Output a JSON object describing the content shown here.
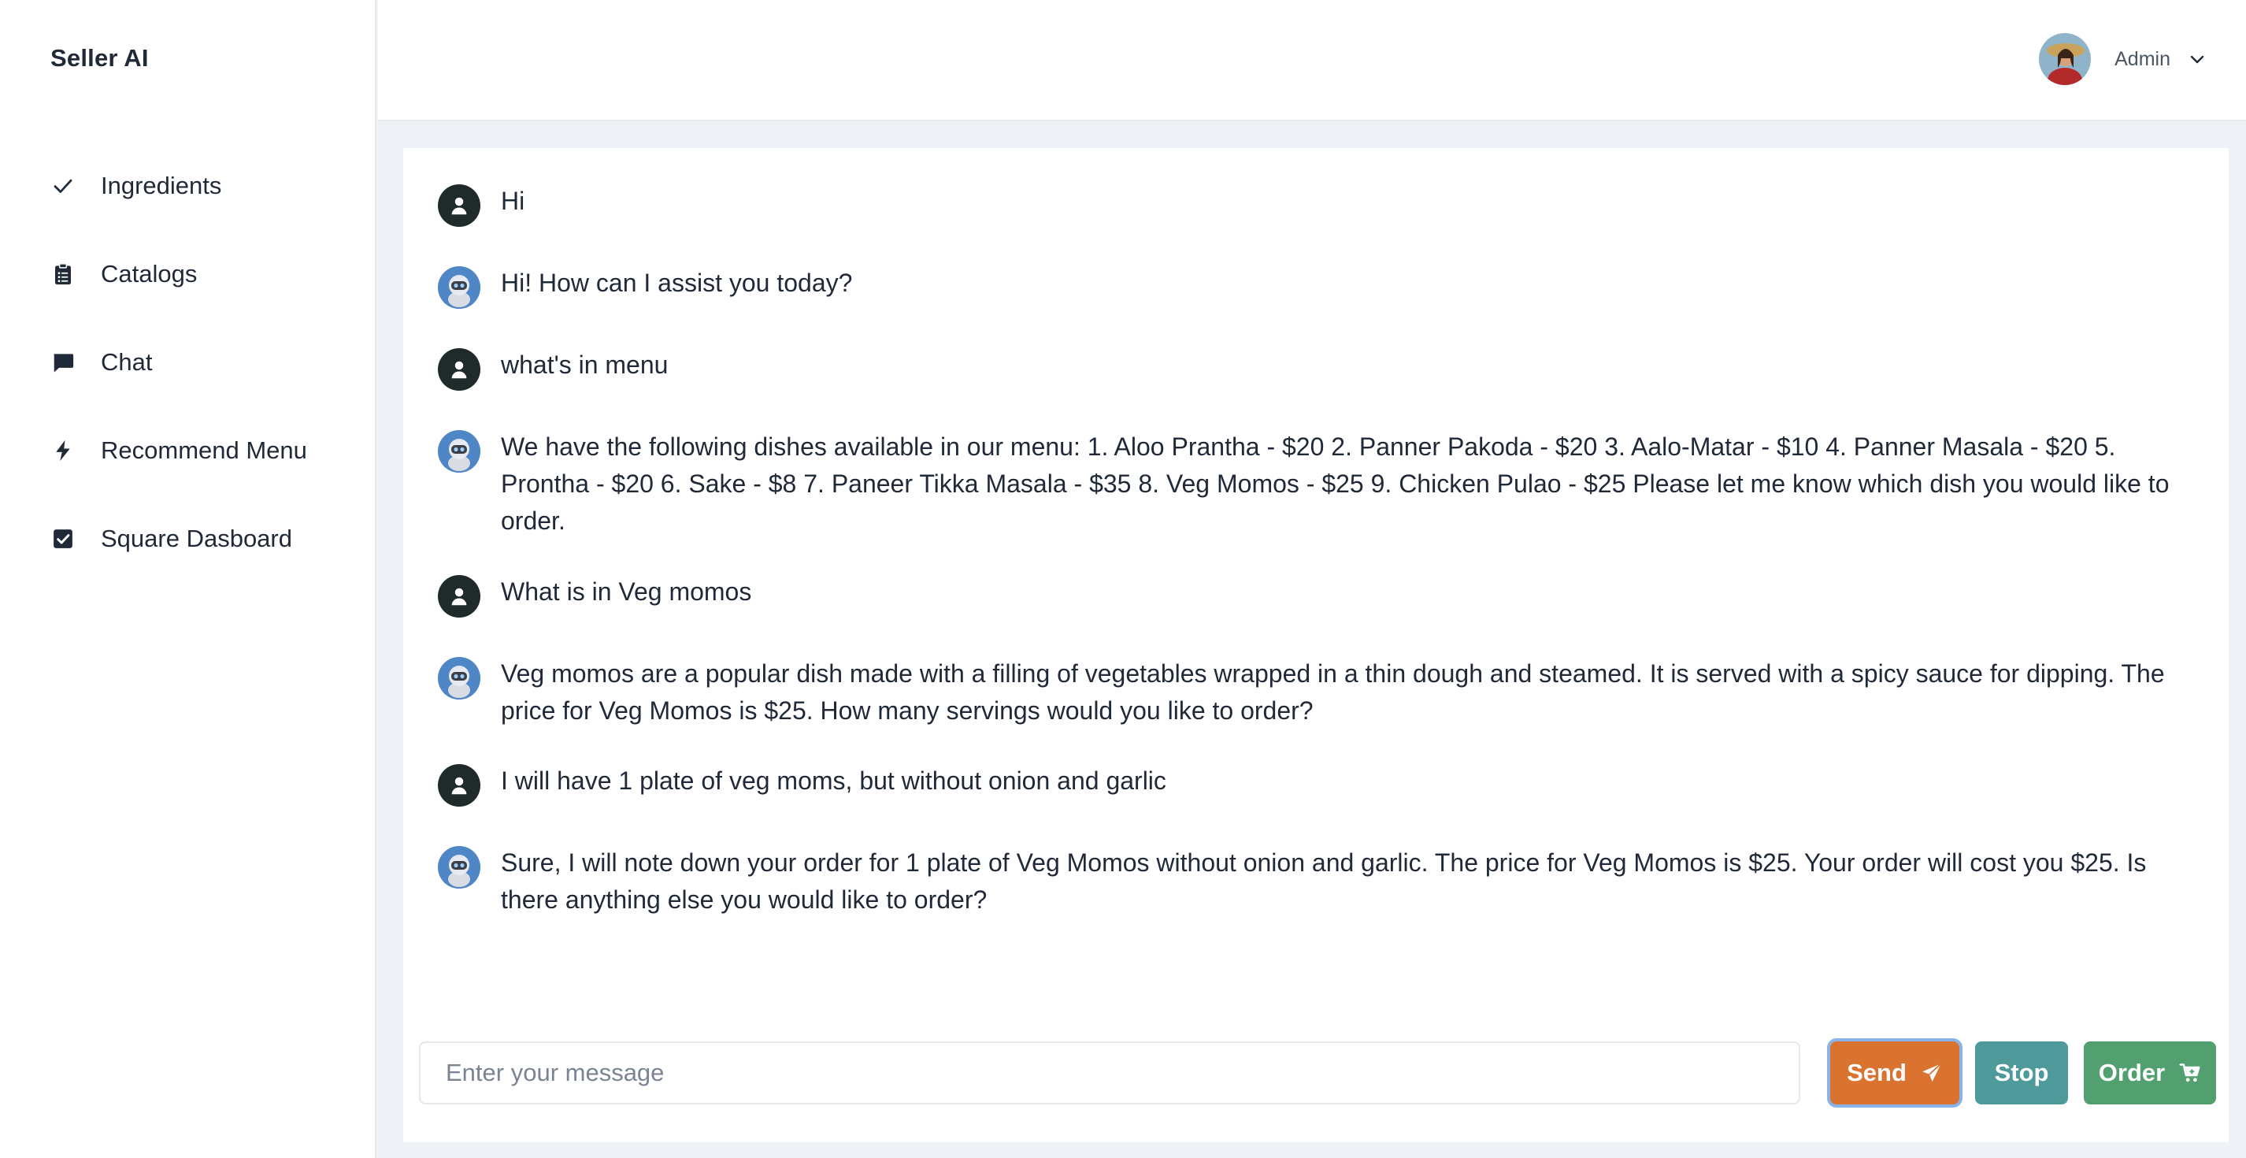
{
  "app": {
    "name": "Seller AI"
  },
  "sidebar": {
    "items": [
      {
        "label": "Ingredients",
        "icon": "check-icon"
      },
      {
        "label": "Catalogs",
        "icon": "clipboard-list-icon"
      },
      {
        "label": "Chat",
        "icon": "chat-bubble-icon"
      },
      {
        "label": "Recommend Menu",
        "icon": "lightning-bolt-icon"
      },
      {
        "label": "Square Dasboard",
        "icon": "checkbox-checked-icon"
      }
    ]
  },
  "header": {
    "user": {
      "name": "Admin",
      "avatar_icon": "user-avatar-photo",
      "menu_icon": "chevron-down-icon"
    }
  },
  "chat": {
    "messages": [
      {
        "role": "user",
        "text": "Hi"
      },
      {
        "role": "bot",
        "text": "Hi! How can I assist you today?"
      },
      {
        "role": "user",
        "text": "what's in menu"
      },
      {
        "role": "bot",
        "text": "We have the following dishes available in our menu: 1. Aloo Prantha - $20 2. Panner Pakoda - $20 3. Aalo-Matar - $10 4. Panner Masala - $20 5. Prontha - $20 6. Sake - $8 7. Paneer Tikka Masala - $35 8. Veg Momos - $25 9. Chicken Pulao - $25 Please let me know which dish you would like to order."
      },
      {
        "role": "user",
        "text": "What is in Veg momos"
      },
      {
        "role": "bot",
        "text": "Veg momos are a popular dish made with a filling of vegetables wrapped in a thin dough and steamed. It is served with a spicy sauce for dipping. The price for Veg Momos is $25. How many servings would you like to order?"
      },
      {
        "role": "user",
        "text": "I will have 1 plate of veg moms, but without onion and garlic"
      },
      {
        "role": "bot",
        "text": "Sure, I will note down your order for 1 plate of Veg Momos without onion and garlic. The price for Veg Momos is $25. Your order will cost you $25. Is there anything else you would like to order?"
      }
    ],
    "input": {
      "placeholder": "Enter your message",
      "value": ""
    },
    "buttons": {
      "send": "Send",
      "stop": "Stop",
      "order": "Order"
    }
  },
  "colors": {
    "send": "#d9732f",
    "stop": "#4e9a9a",
    "order": "#52a070",
    "user_avatar_bg": "#1f2a2b",
    "bot_avatar_bg": "#4f86c6"
  }
}
